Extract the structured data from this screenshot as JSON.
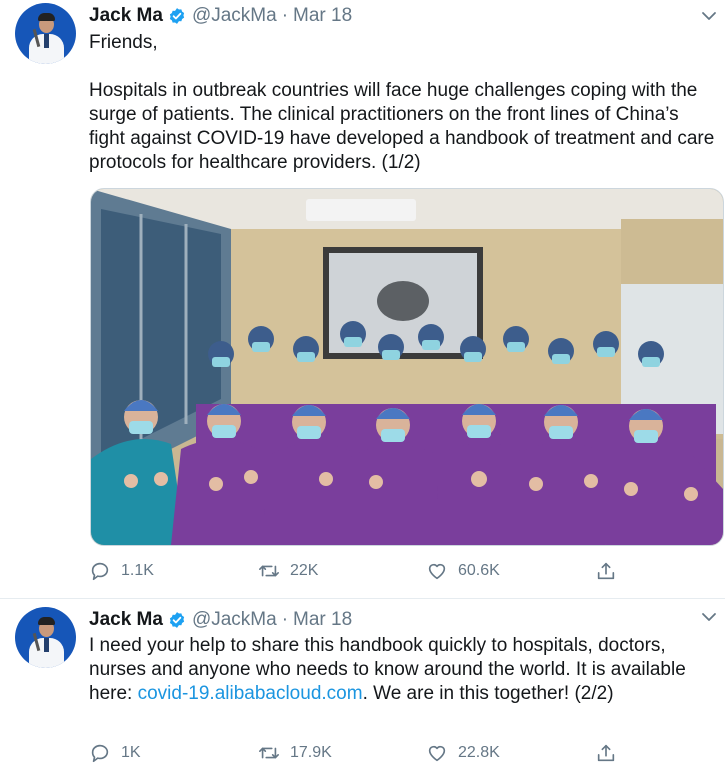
{
  "tweets": [
    {
      "author_name": "Jack Ma",
      "handle": "@JackMa",
      "separator": "·",
      "date": "Mar 18",
      "greeting": "Friends,",
      "body": "Hospitals in outbreak countries will face huge challenges coping with the surge of patients. The clinical practitioners on the front lines of China’s fight against COVID-19 have developed a handbook of treatment and care protocols for healthcare providers. (1/2)",
      "replies": "1.1K",
      "retweets": "22K",
      "likes": "60.6K"
    },
    {
      "author_name": "Jack Ma",
      "handle": "@JackMa",
      "separator": "·",
      "date": "Mar 18",
      "body_before_link": "I need your help to share this handbook quickly to hospitals, doctors, nurses and anyone who needs to know around the world. It is available here: ",
      "link_text": "covid-19.alibabacloud.com",
      "body_after_link": ". We are in this together! (2/2)",
      "replies": "1K",
      "retweets": "17.9K",
      "likes": "22.8K"
    }
  ],
  "colors": {
    "text_primary": "#14171a",
    "text_secondary": "#657786",
    "link": "#1b95e0",
    "verified": "#1da1f2",
    "scrubs_purple": "#7a3e9c",
    "scrubs_teal": "#1f8fa6"
  },
  "icons": [
    "verified-badge-icon",
    "chevron-down-icon",
    "reply-icon",
    "retweet-icon",
    "like-icon",
    "share-icon"
  ]
}
